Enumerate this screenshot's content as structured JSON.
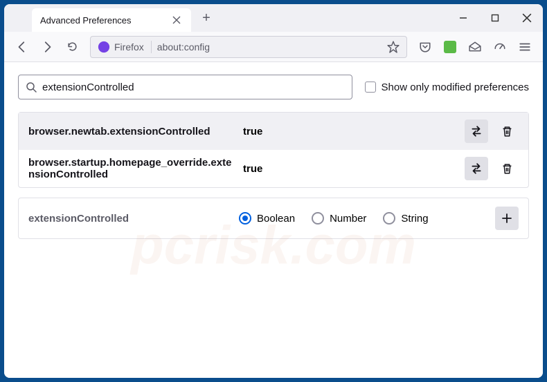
{
  "titlebar": {
    "tab_title": "Advanced Preferences"
  },
  "toolbar": {
    "identity_label": "Firefox",
    "url": "about:config"
  },
  "search": {
    "value": "extensionControlled",
    "show_modified_label": "Show only modified preferences"
  },
  "prefs": [
    {
      "name": "browser.newtab.extensionControlled",
      "value": "true"
    },
    {
      "name": "browser.startup.homepage_override.extensionControlled",
      "value": "true"
    }
  ],
  "new_pref": {
    "name": "extensionControlled",
    "types": [
      "Boolean",
      "Number",
      "String"
    ],
    "selected": "Boolean"
  },
  "watermark": "pcrisk.com"
}
